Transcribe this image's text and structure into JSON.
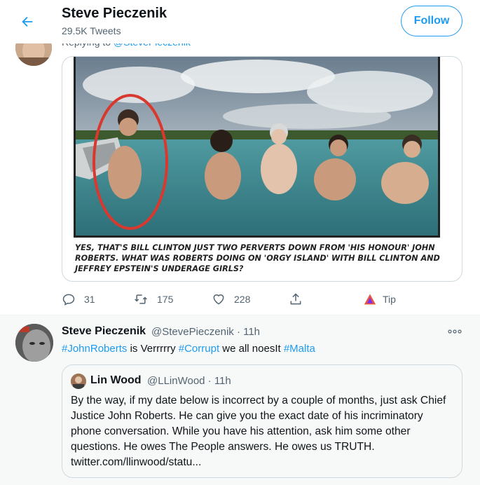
{
  "header": {
    "name": "Steve Pieczenik",
    "tweet_count": "29.5K Tweets",
    "follow_label": "Follow"
  },
  "tweet1": {
    "replying_prefix": "Replying to ",
    "replying_handle": "@StevePieczenik",
    "image_caption": "YES, THAT'S BILL CLINTON JUST TWO PERVERTS DOWN FROM 'HIS HONOUR' JOHN ROBERTS. WHAT WAS ROBERTS DOING ON 'ORGY ISLAND' WITH BILL CLINTON AND JEFFREY EPSTEIN'S UNDERAGE GIRLS?",
    "actions": {
      "replies": "31",
      "retweets": "175",
      "likes": "228",
      "tip_label": "Tip"
    }
  },
  "tweet2": {
    "name": "Steve Pieczenik",
    "meta": "@StevePieczenik · 11h",
    "text_parts": {
      "tag1": "#JohnRoberts",
      "mid1": " is Verrrrry ",
      "tag2": "#Corrupt",
      "mid2": " we all noesIt ",
      "tag3": "#Malta"
    },
    "quote": {
      "name": "Lin Wood",
      "meta": "@LLinWood · 11h",
      "text": "By the way, if my date below is incorrect by a couple of months, just ask Chief Justice John Roberts. He can give you the exact date of his incriminatory phone conversation. While you have his attention, ask him some other questions. He owes The People answers. He owes us TRUTH. twitter.com/llinwood/statu..."
    }
  },
  "colors": {
    "accent": "#1d9bf0",
    "secondary_text": "#536471",
    "border": "#cfd9de",
    "tip_icon": "#e8563f"
  },
  "icons": {
    "back": "arrow-left-icon",
    "reply": "reply-icon",
    "retweet": "retweet-icon",
    "like": "heart-icon",
    "share": "share-icon",
    "tip": "tip-triangle-icon",
    "more": "more-dots-icon"
  }
}
